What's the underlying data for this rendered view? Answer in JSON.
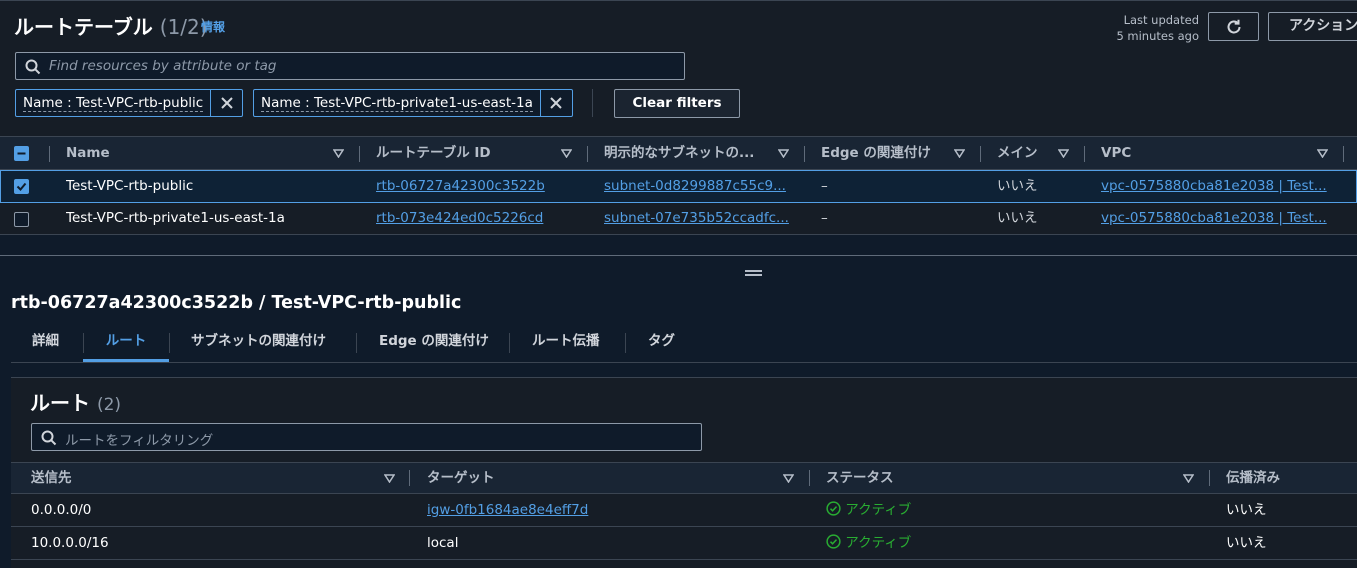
{
  "header": {
    "title": "ルートテーブル",
    "count": "(1/2)",
    "info_link": "情報",
    "last_updated_line1": "Last updated",
    "last_updated_line2": "5 minutes ago",
    "actions_label": "アクション"
  },
  "search": {
    "placeholder": "Find resources by attribute or tag"
  },
  "filters": [
    {
      "label": "Name : Test-VPC-rtb-public"
    },
    {
      "label": "Name : Test-VPC-rtb-private1-us-east-1a"
    }
  ],
  "clear_filters_label": "Clear filters",
  "table": {
    "columns": [
      "Name",
      "ルートテーブル ID",
      "明示的なサブネットの...",
      "Edge の関連付け",
      "メイン",
      "VPC"
    ],
    "rows": [
      {
        "selected": true,
        "name": "Test-VPC-rtb-public",
        "id": "rtb-06727a42300c3522b",
        "subnet": "subnet-0d8299887c55c9...",
        "edge": "–",
        "main": "いいえ",
        "vpc": "vpc-0575880cba81e2038 | Test..."
      },
      {
        "selected": false,
        "name": "Test-VPC-rtb-private1-us-east-1a",
        "id": "rtb-073e424ed0c5226cd",
        "subnet": "subnet-07e735b52ccadfc...",
        "edge": "–",
        "main": "いいえ",
        "vpc": "vpc-0575880cba81e2038 | Test..."
      }
    ]
  },
  "detail": {
    "title": "rtb-06727a42300c3522b / Test-VPC-rtb-public",
    "tabs": [
      "詳細",
      "ルート",
      "サブネットの関連付け",
      "Edge の関連付け",
      "ルート伝播",
      "タグ"
    ],
    "active_tab": "ルート"
  },
  "routes": {
    "title": "ルート",
    "count": "(2)",
    "search_placeholder": "ルートをフィルタリング",
    "columns": [
      "送信先",
      "ターゲット",
      "ステータス",
      "伝播済み"
    ],
    "rows": [
      {
        "destination": "0.0.0.0/0",
        "target": "igw-0fb1684ae8e4eff7d",
        "target_is_link": true,
        "status": "アクティブ",
        "propagated": "いいえ"
      },
      {
        "destination": "10.0.0.0/16",
        "target": "local",
        "target_is_link": false,
        "status": "アクティブ",
        "propagated": "いいえ"
      }
    ]
  },
  "colors": {
    "background": "#0f1b2a",
    "panel": "#161d26",
    "link": "#539fe5",
    "status_active": "#29ad32"
  }
}
